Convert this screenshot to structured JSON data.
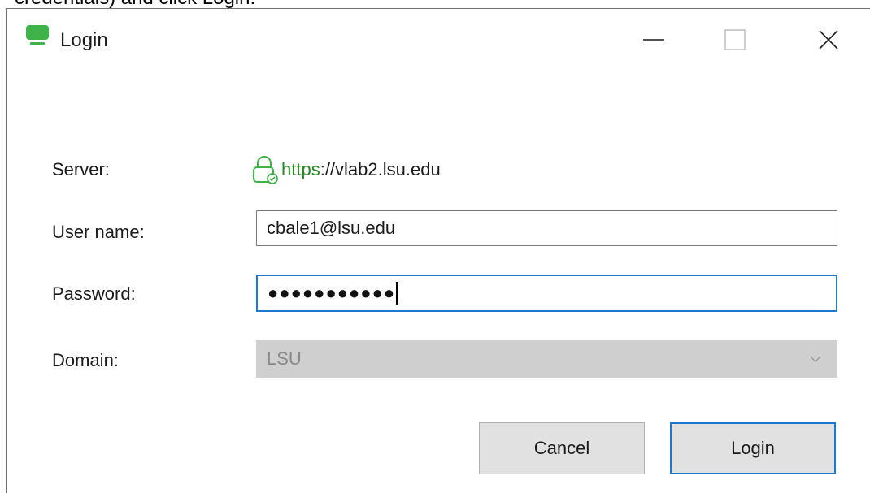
{
  "instruction_caption": "credentials) and click Login.",
  "window": {
    "title": "Login",
    "icon": "monitor-icon",
    "accent_color": "#3fb24a",
    "controls": {
      "minimize": "minimize-icon",
      "maximize": "maximize-icon",
      "close": "close-icon"
    }
  },
  "form": {
    "server": {
      "label": "Server:",
      "scheme": "https",
      "rest": "://vlab2.lsu.edu",
      "scheme_color": "#1f8a1f"
    },
    "username": {
      "label": "User name:",
      "value": "cbale1@lsu.edu"
    },
    "password": {
      "label": "Password:",
      "masked_value": "●●●●●●●●●●●"
    },
    "domain": {
      "label": "Domain:",
      "value": "LSU",
      "disabled": true
    }
  },
  "buttons": {
    "cancel_label": "Cancel",
    "login_label": "Login"
  },
  "focus_color": "#1e78d2"
}
